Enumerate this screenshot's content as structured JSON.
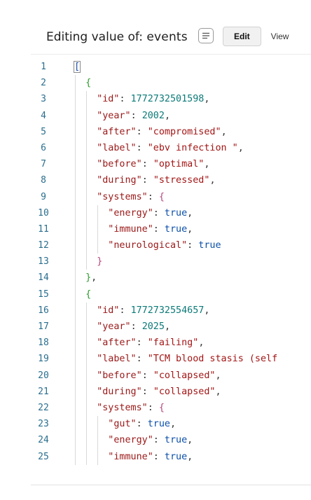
{
  "header": {
    "title_prefix": "Editing value of: ",
    "field_name": "events",
    "menu_icon": "lines-icon",
    "tabs": [
      {
        "label": "Edit",
        "active": true
      },
      {
        "label": "View",
        "active": false
      }
    ]
  },
  "editor": {
    "lines": [
      {
        "n": "1",
        "indent": 0,
        "tokens": [
          [
            "bracket-box",
            "["
          ]
        ]
      },
      {
        "n": "2",
        "indent": 1,
        "tokens": [
          [
            "brace",
            "{"
          ]
        ]
      },
      {
        "n": "3",
        "indent": 2,
        "tokens": [
          [
            "key",
            "\"id\""
          ],
          [
            "punc",
            ": "
          ],
          [
            "num",
            "1772732501598"
          ],
          [
            "punc",
            ","
          ]
        ]
      },
      {
        "n": "4",
        "indent": 2,
        "tokens": [
          [
            "key",
            "\"year\""
          ],
          [
            "punc",
            ": "
          ],
          [
            "num",
            "2002"
          ],
          [
            "punc",
            ","
          ]
        ]
      },
      {
        "n": "5",
        "indent": 2,
        "tokens": [
          [
            "key",
            "\"after\""
          ],
          [
            "punc",
            ": "
          ],
          [
            "str",
            "\"compromised\""
          ],
          [
            "punc",
            ","
          ]
        ]
      },
      {
        "n": "6",
        "indent": 2,
        "tokens": [
          [
            "key",
            "\"label\""
          ],
          [
            "punc",
            ": "
          ],
          [
            "str",
            "\"ebv infection \""
          ],
          [
            "punc",
            ","
          ]
        ]
      },
      {
        "n": "7",
        "indent": 2,
        "tokens": [
          [
            "key",
            "\"before\""
          ],
          [
            "punc",
            ": "
          ],
          [
            "str",
            "\"optimal\""
          ],
          [
            "punc",
            ","
          ]
        ]
      },
      {
        "n": "8",
        "indent": 2,
        "tokens": [
          [
            "key",
            "\"during\""
          ],
          [
            "punc",
            ": "
          ],
          [
            "str",
            "\"stressed\""
          ],
          [
            "punc",
            ","
          ]
        ]
      },
      {
        "n": "9",
        "indent": 2,
        "tokens": [
          [
            "key",
            "\"systems\""
          ],
          [
            "punc",
            ": "
          ],
          [
            "brace2",
            "{"
          ]
        ]
      },
      {
        "n": "10",
        "indent": 3,
        "tokens": [
          [
            "key",
            "\"energy\""
          ],
          [
            "punc",
            ": "
          ],
          [
            "bool",
            "true"
          ],
          [
            "punc",
            ","
          ]
        ]
      },
      {
        "n": "11",
        "indent": 3,
        "tokens": [
          [
            "key",
            "\"immune\""
          ],
          [
            "punc",
            ": "
          ],
          [
            "bool",
            "true"
          ],
          [
            "punc",
            ","
          ]
        ]
      },
      {
        "n": "12",
        "indent": 3,
        "tokens": [
          [
            "key",
            "\"neurological\""
          ],
          [
            "punc",
            ": "
          ],
          [
            "bool",
            "true"
          ]
        ]
      },
      {
        "n": "13",
        "indent": 2,
        "tokens": [
          [
            "brace2",
            "}"
          ]
        ]
      },
      {
        "n": "14",
        "indent": 1,
        "tokens": [
          [
            "brace",
            "}"
          ],
          [
            "punc",
            ","
          ]
        ]
      },
      {
        "n": "15",
        "indent": 1,
        "tokens": [
          [
            "brace",
            "{"
          ]
        ]
      },
      {
        "n": "16",
        "indent": 2,
        "tokens": [
          [
            "key",
            "\"id\""
          ],
          [
            "punc",
            ": "
          ],
          [
            "num",
            "1772732554657"
          ],
          [
            "punc",
            ","
          ]
        ]
      },
      {
        "n": "17",
        "indent": 2,
        "tokens": [
          [
            "key",
            "\"year\""
          ],
          [
            "punc",
            ": "
          ],
          [
            "num",
            "2025"
          ],
          [
            "punc",
            ","
          ]
        ]
      },
      {
        "n": "18",
        "indent": 2,
        "tokens": [
          [
            "key",
            "\"after\""
          ],
          [
            "punc",
            ": "
          ],
          [
            "str",
            "\"failing\""
          ],
          [
            "punc",
            ","
          ]
        ]
      },
      {
        "n": "19",
        "indent": 2,
        "tokens": [
          [
            "key",
            "\"label\""
          ],
          [
            "punc",
            ": "
          ],
          [
            "str",
            "\"TCM blood stasis (self"
          ]
        ]
      },
      {
        "n": "20",
        "indent": 2,
        "tokens": [
          [
            "key",
            "\"before\""
          ],
          [
            "punc",
            ": "
          ],
          [
            "str",
            "\"collapsed\""
          ],
          [
            "punc",
            ","
          ]
        ]
      },
      {
        "n": "21",
        "indent": 2,
        "tokens": [
          [
            "key",
            "\"during\""
          ],
          [
            "punc",
            ": "
          ],
          [
            "str",
            "\"collapsed\""
          ],
          [
            "punc",
            ","
          ]
        ]
      },
      {
        "n": "22",
        "indent": 2,
        "tokens": [
          [
            "key",
            "\"systems\""
          ],
          [
            "punc",
            ": "
          ],
          [
            "brace2",
            "{"
          ]
        ]
      },
      {
        "n": "23",
        "indent": 3,
        "tokens": [
          [
            "key",
            "\"gut\""
          ],
          [
            "punc",
            ": "
          ],
          [
            "bool",
            "true"
          ],
          [
            "punc",
            ","
          ]
        ]
      },
      {
        "n": "24",
        "indent": 3,
        "tokens": [
          [
            "key",
            "\"energy\""
          ],
          [
            "punc",
            ": "
          ],
          [
            "bool",
            "true"
          ],
          [
            "punc",
            ","
          ]
        ]
      },
      {
        "n": "25",
        "indent": 3,
        "tokens": [
          [
            "key",
            "\"immune\""
          ],
          [
            "punc",
            ": "
          ],
          [
            "bool",
            "true"
          ],
          [
            "punc",
            ","
          ]
        ]
      }
    ]
  },
  "colors": {
    "line_number": "#2a6e8e",
    "key": "#9a1818",
    "string": "#a31515",
    "number": "#0b7a78",
    "boolean": "#0b4fa8",
    "brace_outer": "#2e9a2e",
    "brace_inner": "#b5467c"
  }
}
